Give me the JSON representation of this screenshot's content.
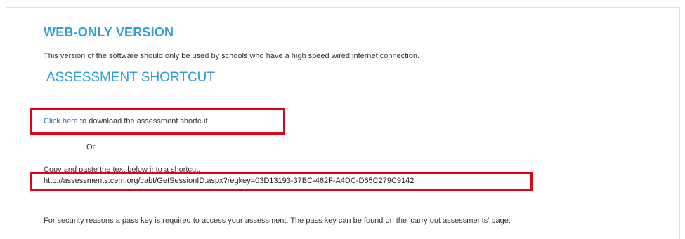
{
  "header": {
    "title": "WEB-ONLY VERSION",
    "description": "This version of the software should only be used by schools who have a high speed wired internet connection."
  },
  "shortcut": {
    "heading": "ASSESSMENT SHORTCUT",
    "link_text": "Click here",
    "link_suffix": " to download the assessment shortcut.",
    "or_text": "Or",
    "copy_label": "Copy and paste the text below into a shortcut.",
    "url": "http://assessments.cem.org/cabt/GetSessionID.aspx?regkey=03D13193-37BC-462F-A4DC-D65C279C9142"
  },
  "security": {
    "text": "For security reasons a pass key is required to access your assessment. The pass key can be found on the 'carry out assessments' page."
  },
  "colors": {
    "heading_blue": "#2e9fd8",
    "link_blue": "#2a6fb8",
    "highlight_red": "#e3001b"
  }
}
